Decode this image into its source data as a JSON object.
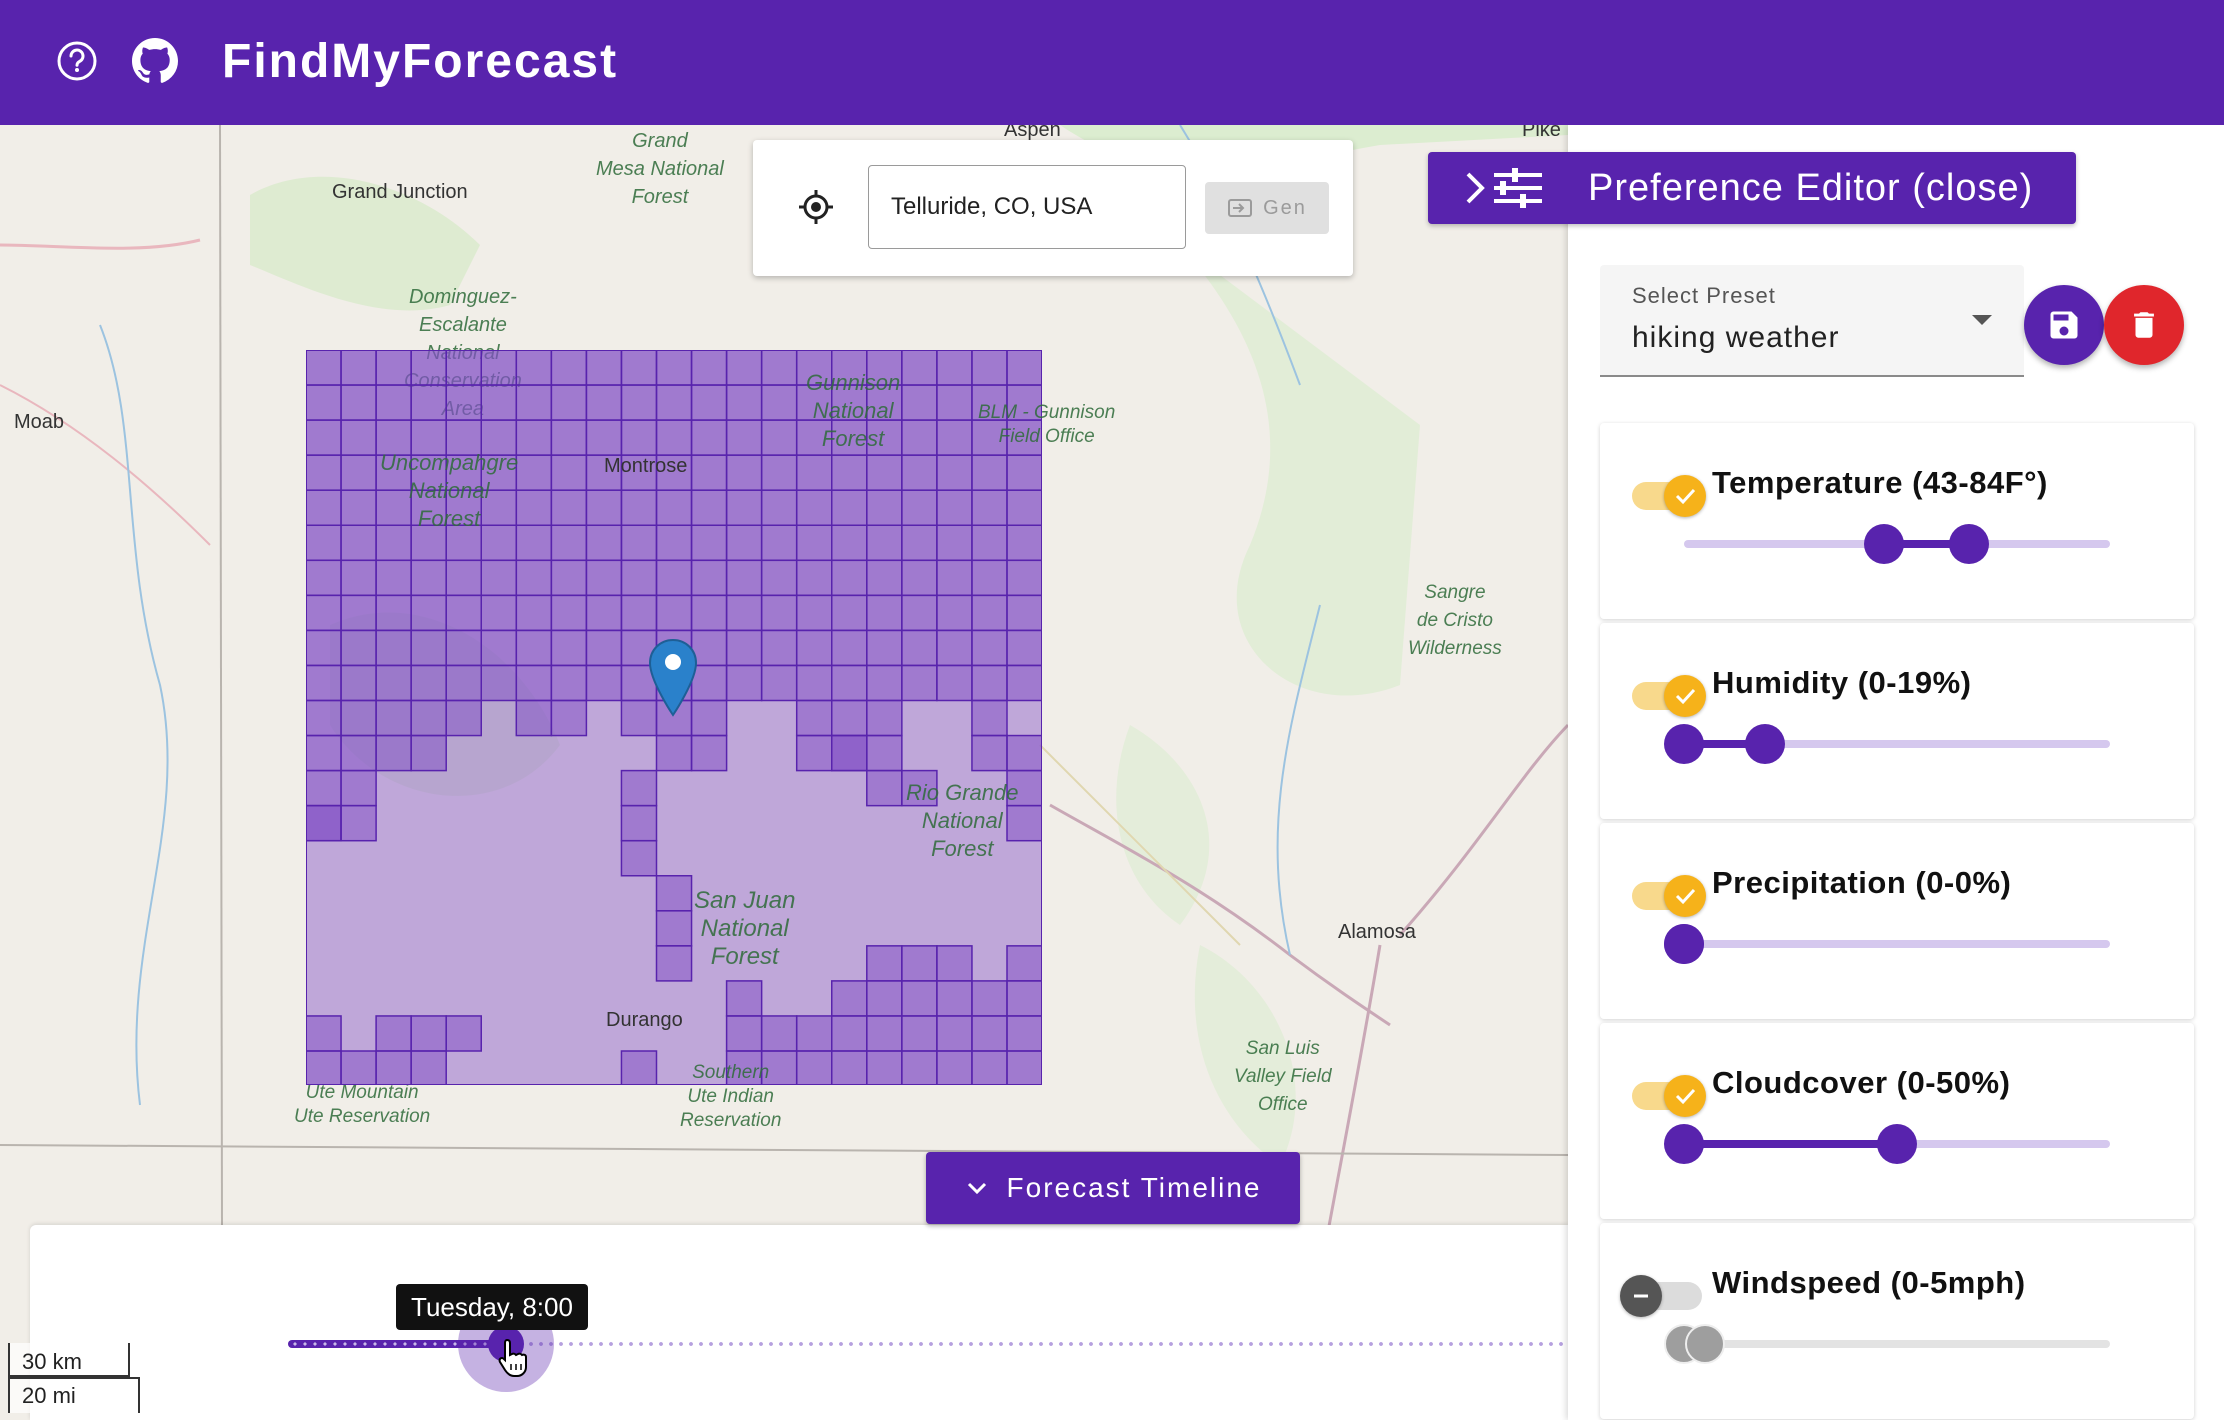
{
  "app": {
    "title": "FindMyForecast",
    "help_icon": "help-circle-icon",
    "github_icon": "github-icon"
  },
  "search": {
    "value": "Telluride, CO, USA",
    "gen_label": "Gen",
    "locate_icon": "crosshair-icon"
  },
  "map": {
    "places": {
      "grand_junction": "Grand Junction",
      "aspen": "Aspen",
      "pike": "Pike",
      "moab": "Moab",
      "montrose": "Montrose",
      "alamosa": "Alamosa",
      "durango": "Durango"
    },
    "areas": {
      "grand_mesa": "Grand\nMesa National\nForest",
      "dominguez": "Dominguez-\nEscalante\nNational\nConservation\nArea",
      "uncompahgre": "Uncompahgre\nNational\nForest",
      "gunnison": "Gunnison\nNational\nForest",
      "blm_gunnison": "BLM - Gunnison\nField Office",
      "sangre": "Sangre\nde Cristo\nWilderness",
      "rio_grande": "Rio Grande\nNational\nForest",
      "san_juan": "San Juan\nNational\nForest",
      "san_luis": "San Luis\nValley Field\nOffice",
      "ute_mountain": "Ute Mountain\nUte Reservation",
      "southern_ute": "Southern\nUte Indian\nReservation"
    },
    "scale": {
      "km": "30 km",
      "mi": "20 mi"
    }
  },
  "timeline": {
    "button_label": "Forecast Timeline",
    "tooltip": "Tuesday, 8:00",
    "position_fraction": 0.17
  },
  "preferences": {
    "toggle_label": "Preference Editor (close)",
    "preset_label": "Select Preset",
    "preset_value": "hiking weather",
    "items": [
      {
        "label": "Temperature (43-84F°)",
        "enabled": true,
        "range": [
          0.47,
          0.67
        ]
      },
      {
        "label": "Humidity (0-19%)",
        "enabled": true,
        "range": [
          0.0,
          0.19
        ]
      },
      {
        "label": "Precipitation (0-0%)",
        "enabled": true,
        "range": [
          0.0,
          0.0
        ]
      },
      {
        "label": "Cloudcover (0-50%)",
        "enabled": true,
        "range": [
          0.0,
          0.5
        ]
      },
      {
        "label": "Windspeed (0-5mph)",
        "enabled": false,
        "range": [
          0.0,
          0.05
        ]
      }
    ]
  },
  "colors": {
    "brand": "#5823ad",
    "switch_on": "#f6b21a",
    "delete": "#e0262c"
  }
}
